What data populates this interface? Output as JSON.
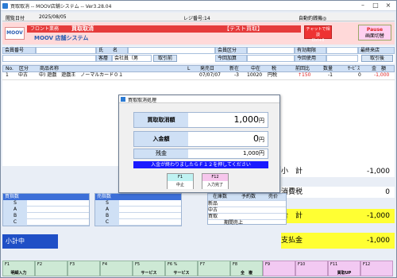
{
  "window": {
    "title": "買取取消 -- MOOV店舗システム -- Ver3.28.04"
  },
  "infobar": {
    "date_label": "閲覧日付",
    "date": "2025/08/05",
    "reg_label": "レジ番号:14",
    "auto_label": "自動釣銭機◎"
  },
  "header": {
    "logo": "MOOV",
    "front_label": "フロント業務",
    "screen_title": "買取取消",
    "test_label": "【テスト買取】",
    "system_name": "MOOV 店舗システム",
    "check_button_line1": "チャットで相談",
    "check_button_line2": "Ctrl+ll",
    "pause_label": "Pause",
    "screen_switch": "画面切替"
  },
  "customer": {
    "member_no_label": "会員番号",
    "name_label": "氏　　名",
    "member_type_label": "会員区分",
    "expiry_label": "有効期限",
    "last_visit_label": "最終来店",
    "customer_type_label": "客層",
    "customer_type_value": "会社員（男",
    "customer_pull_button": "取引前",
    "point_add_label": "今回加算",
    "point_use_label": "今回使用",
    "history_button": "取引後"
  },
  "grid": {
    "headers": [
      "No.",
      "区分",
      "商品名称",
      "L",
      "発売日",
      "新在",
      "中在",
      "税",
      "前回比",
      "数量",
      "ｻｰﾋﾞｽ",
      "金　額"
    ],
    "rows": [
      {
        "no": "1",
        "kind": "中古",
        "name": "中) 遊戯　遊戯王　ノーマルカード０１",
        "release": "07/07/07",
        "new_stock": "-3",
        "used_stock": "10020",
        "tax": "円税",
        "prev": "↑150",
        "qty": "-1",
        "service": "0",
        "amount": "-1,000"
      }
    ]
  },
  "dialog": {
    "title": "買取取消処理",
    "cancel_amount_label": "買取取消額",
    "cancel_amount": "1,000",
    "deposit_label": "入金額",
    "deposit": "0",
    "remaining_label": "残金",
    "remaining": "1,000円",
    "yen": "円",
    "message": "入金が終わりましたらＦ１２を押してください",
    "f1_key": "F1",
    "f1_label": "中止",
    "f12_key": "F12",
    "f12_label": "入力完了"
  },
  "summary": {
    "subtotal_label": "小　計",
    "subtotal": "-1,000",
    "tax_label": "消費税",
    "tax": "0",
    "total_label": "合　計",
    "total": "-1,000",
    "payment_label": "支払金",
    "payment": "-1,000"
  },
  "panels": {
    "buy_count_title": "買指数",
    "sell_count_title": "売指数",
    "grades": [
      "S",
      "A",
      "B",
      "C"
    ],
    "stock_headers": [
      "在庫数",
      "予約数",
      "売价"
    ],
    "stock_rows": [
      "新品",
      "中古",
      "買取",
      "期間売上"
    ],
    "subtotal_bar": "小計中"
  },
  "fkeys": [
    {
      "key": "F1",
      "label": "明細入力",
      "pink": false
    },
    {
      "key": "F2",
      "label": "",
      "pink": false
    },
    {
      "key": "F3",
      "label": "",
      "pink": false
    },
    {
      "key": "F4",
      "label": "",
      "pink": false
    },
    {
      "key": "F5",
      "label": "サービス",
      "pink": false
    },
    {
      "key": "F6 %",
      "label": "サービス",
      "pink": false
    },
    {
      "key": "F7",
      "label": "",
      "pink": false
    },
    {
      "key": "F8",
      "label": "全　複",
      "pink": false
    },
    {
      "key": "F9",
      "label": "",
      "pink": true
    },
    {
      "key": "F10",
      "label": "",
      "pink": true
    },
    {
      "key": "F11",
      "label": "買取UP",
      "pink": true
    },
    {
      "key": "F12",
      "label": "",
      "pink": true
    }
  ]
}
